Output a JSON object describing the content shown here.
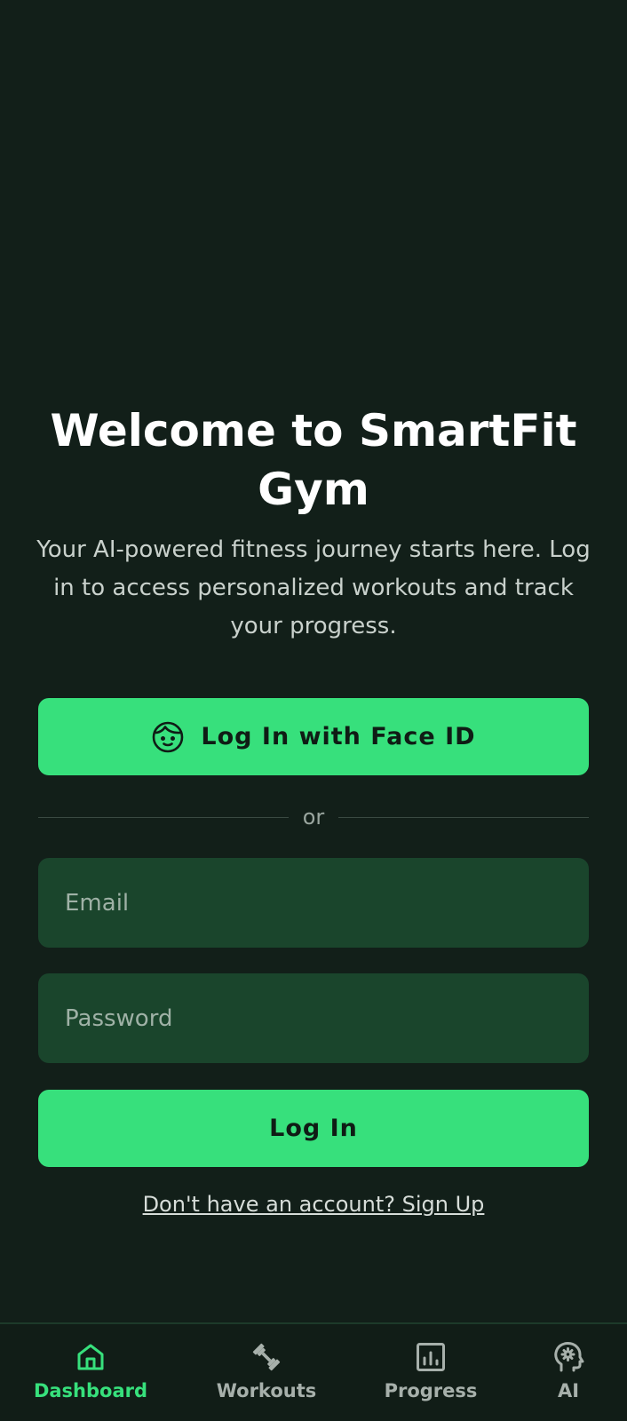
{
  "welcome": {
    "title": "Welcome to SmartFit Gym",
    "subtitle": "Your AI-powered fitness journey starts here. Log in to access personalized workouts and track your progress."
  },
  "face_login": {
    "label": "Log In with Face ID",
    "icon": "face-icon"
  },
  "divider": {
    "label": "or"
  },
  "form": {
    "email_placeholder": "Email",
    "password_placeholder": "Password",
    "login_label": "Log In"
  },
  "signup_link": "Don't have an account? Sign Up",
  "nav": {
    "items": [
      {
        "label": "Dashboard",
        "icon": "home-icon",
        "active": true
      },
      {
        "label": "Workouts",
        "icon": "dumbbell-icon",
        "active": false
      },
      {
        "label": "Progress",
        "icon": "chart-icon",
        "active": false
      },
      {
        "label": "AI",
        "icon": "ai-head-icon",
        "active": false
      }
    ]
  },
  "colors": {
    "background": "#121f19",
    "accent": "#37e07c",
    "field_bg": "#1a452c",
    "text_muted": "#a7b0ab"
  }
}
